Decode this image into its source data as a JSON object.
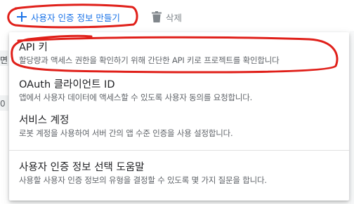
{
  "toolbar": {
    "create_label": "사용자 인증 정보 만들기",
    "delete_label": "삭제"
  },
  "background": {
    "glyph_a": "면",
    "glyph_b": "0"
  },
  "menu": {
    "items": [
      {
        "title": "API 키",
        "description": "할당량과 액세스 권한을 확인하기 위해 간단한 API 키로 프로젝트를 확인합니다"
      },
      {
        "title": "OAuth 클라이언트 ID",
        "description": "앱에서 사용자 데이터에 액세스할 수 있도록 사용자 동의를 요청합니다."
      },
      {
        "title": "서비스 계정",
        "description": "로봇 계정을 사용하여 서버 간의 앱 수준 인증을 사용 설정합니다."
      },
      {
        "title": "사용자 인증 정보 선택 도움말",
        "description": "사용할 사용자 인증 정보의 유형을 결정할 수 있도록 몇 가지 질문을 합니다."
      }
    ]
  },
  "colors": {
    "accent": "#1a73e8",
    "annotation": "#e0201a",
    "muted": "#80868b"
  }
}
